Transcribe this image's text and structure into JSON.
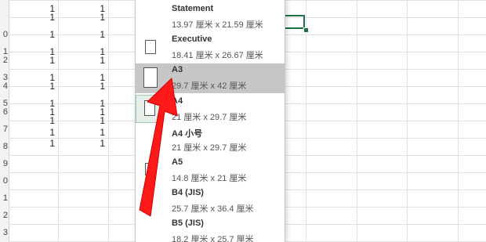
{
  "spreadsheet": {
    "row_numbers": [
      "",
      "",
      "0",
      "1",
      "2",
      "3",
      "4",
      "5",
      "6",
      "7",
      "8",
      "9",
      "0",
      "1",
      "2",
      "3"
    ],
    "col_b_values": [
      "1",
      "1",
      "1",
      "1",
      "1",
      "1",
      "1",
      "1",
      "1",
      "1",
      "1",
      "1"
    ],
    "col_c_values": [
      "1",
      "1",
      "1",
      "1",
      "1",
      "1",
      "1",
      "1",
      "1",
      "1",
      "1",
      "1"
    ]
  },
  "paper_menu": {
    "items": [
      {
        "name": "Statement",
        "size": "13.97 厘米 x 21.59 厘米"
      },
      {
        "name": "Executive",
        "size": "18.41 厘米 x 26.67 厘米"
      },
      {
        "name": "A3",
        "size": "29.7 厘米 x 42 厘米"
      },
      {
        "name": "A4",
        "size": "21 厘米 x 29.7 厘米"
      },
      {
        "name": "A4 小号",
        "size": "21 厘米 x 29.7 厘米"
      },
      {
        "name": "A5",
        "size": "14.8 厘米 x 21 厘米"
      },
      {
        "name": "B4 (JIS)",
        "size": "25.7 厘米 x 36.4 厘米"
      },
      {
        "name": "B5 (JIS)",
        "size": "18.2 厘米 x 25.7 厘米"
      }
    ],
    "highlighted_item": "A3"
  },
  "colors": {
    "highlight": "#c6c6c6",
    "selection": "#1e7145",
    "annotation_arrow": "#ff1a1a"
  }
}
